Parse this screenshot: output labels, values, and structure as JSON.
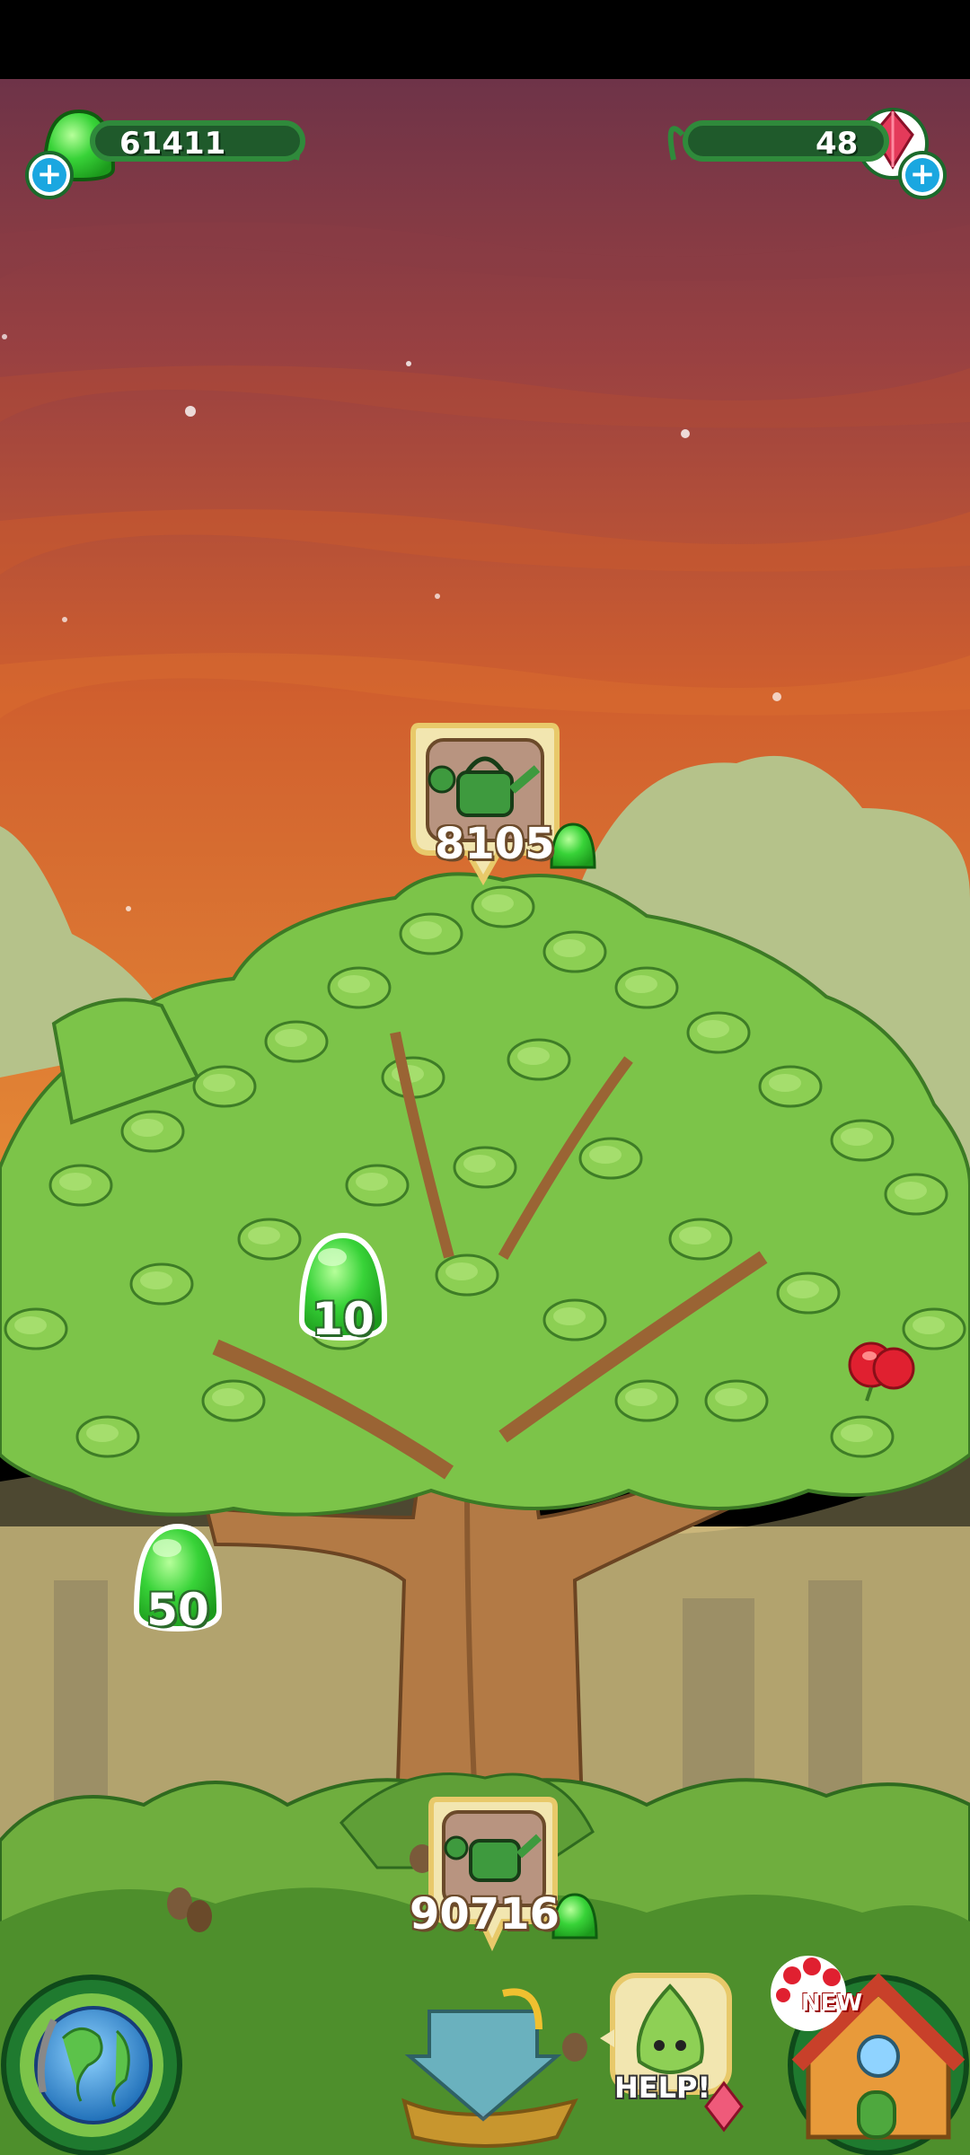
{
  "hud": {
    "gumdrops": {
      "value": "61411",
      "icon": "gumdrop-icon",
      "add_icon": "plus-icon"
    },
    "gems": {
      "value": "48",
      "icon": "red-gem-icon",
      "add_icon": "plus-icon"
    }
  },
  "upgrades": {
    "top_watering_can": {
      "cost": "8105",
      "icon": "watering-can-icon",
      "currency_icon": "gumdrop-icon"
    },
    "bottom_watering_can": {
      "cost": "90716",
      "icon": "watering-can-icon",
      "currency_icon": "gumdrop-icon"
    }
  },
  "drops": [
    {
      "value": "10",
      "icon": "gumdrop-icon"
    },
    {
      "value": "50",
      "icon": "gumdrop-icon"
    }
  ],
  "bottom_bar": {
    "help_label": "HELP!",
    "new_badge": "NEW",
    "globe_icon": "globe-icon",
    "nest_icon": "nest-arrow-icon",
    "house_icon": "house-icon"
  },
  "colors": {
    "gumdrop": "#2ecc2e",
    "hud_bar": "#1f5a2b",
    "sky_top": "#7a3a45",
    "sky_bottom": "#e0782c",
    "leaf": "#7cc449"
  }
}
